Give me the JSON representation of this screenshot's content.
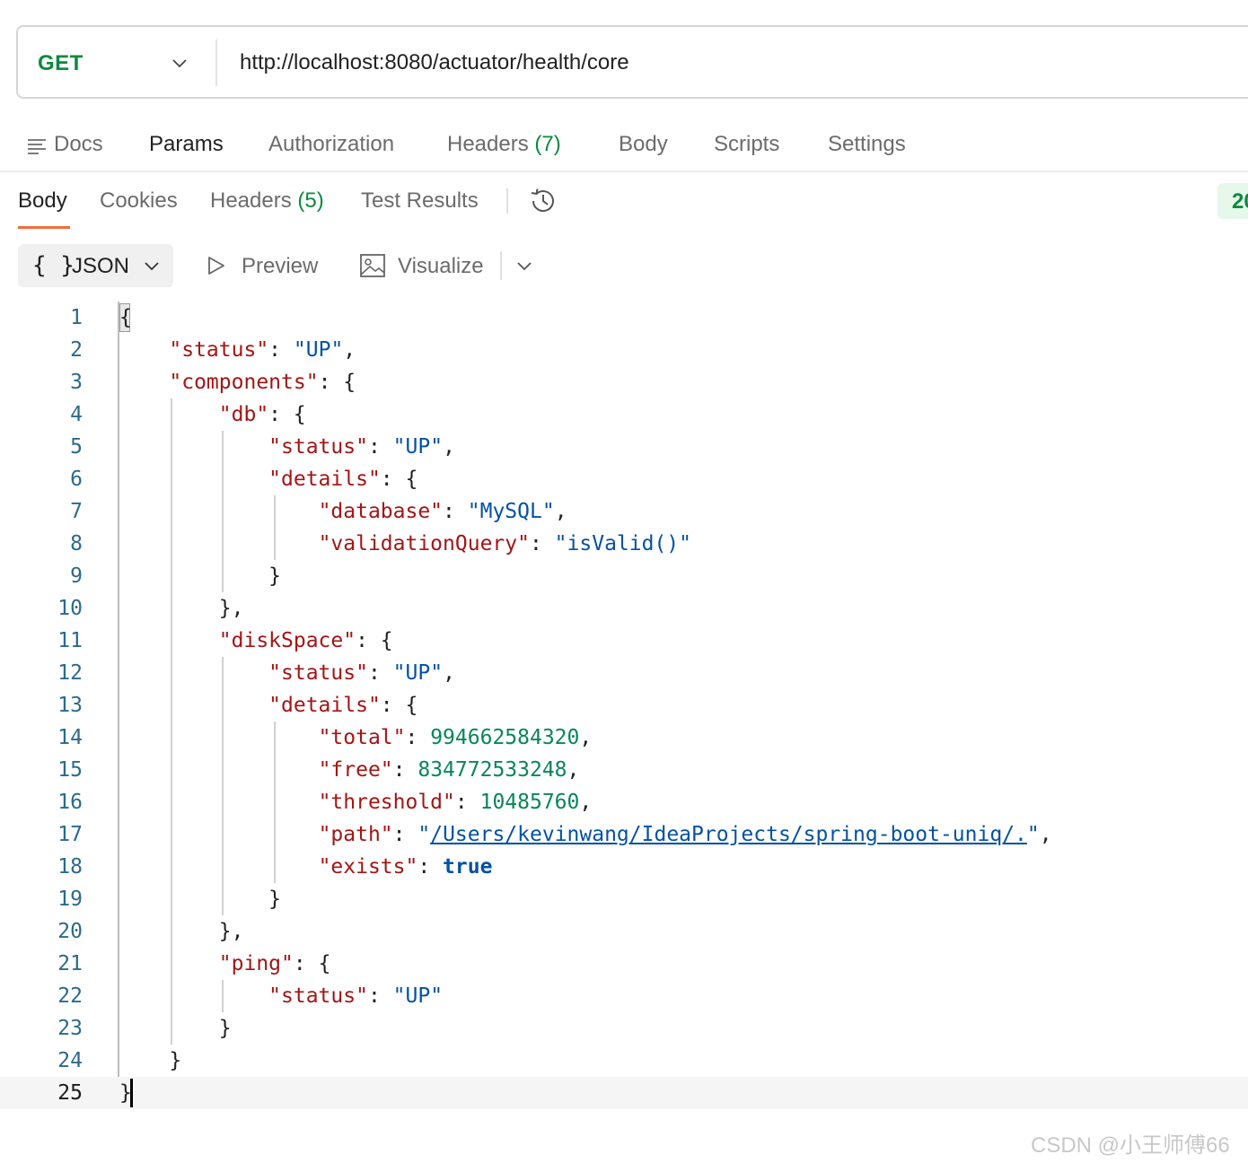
{
  "request": {
    "method": "GET",
    "url": "http://localhost:8080/actuator/health/core"
  },
  "request_tabs": {
    "docs": "Docs",
    "params": "Params",
    "authorization": "Authorization",
    "headers": "Headers",
    "headers_count": "(7)",
    "body": "Body",
    "scripts": "Scripts",
    "settings": "Settings"
  },
  "response_tabs": {
    "body": "Body",
    "cookies": "Cookies",
    "headers": "Headers",
    "headers_count": "(5)",
    "test_results": "Test Results",
    "status_partial": "20"
  },
  "format_bar": {
    "braces": "{ }",
    "format": "JSON",
    "preview": "Preview",
    "visualize": "Visualize"
  },
  "editor": {
    "line_numbers": [
      "1",
      "2",
      "3",
      "4",
      "5",
      "6",
      "7",
      "8",
      "9",
      "10",
      "11",
      "12",
      "13",
      "14",
      "15",
      "16",
      "17",
      "18",
      "19",
      "20",
      "21",
      "22",
      "23",
      "24",
      "25"
    ],
    "current_line": "25",
    "json": {
      "status": "UP",
      "components": {
        "db": {
          "status": "UP",
          "details": {
            "database": "MySQL",
            "validationQuery": "isValid()"
          }
        },
        "diskSpace": {
          "status": "UP",
          "details": {
            "total": "994662584320",
            "free": "834772533248",
            "threshold": "10485760",
            "path": "/Users/kevinwang/IdeaProjects/spring-boot-uniq/.",
            "exists": "true"
          }
        },
        "ping": {
          "status": "UP"
        }
      }
    }
  },
  "watermark": "CSDN @小王师傅66",
  "colors": {
    "method_green": "#0b8a3e",
    "active_tab_underline": "#f26b3a",
    "json_key": "#a31515",
    "json_string": "#0451a5",
    "json_number": "#098658"
  }
}
